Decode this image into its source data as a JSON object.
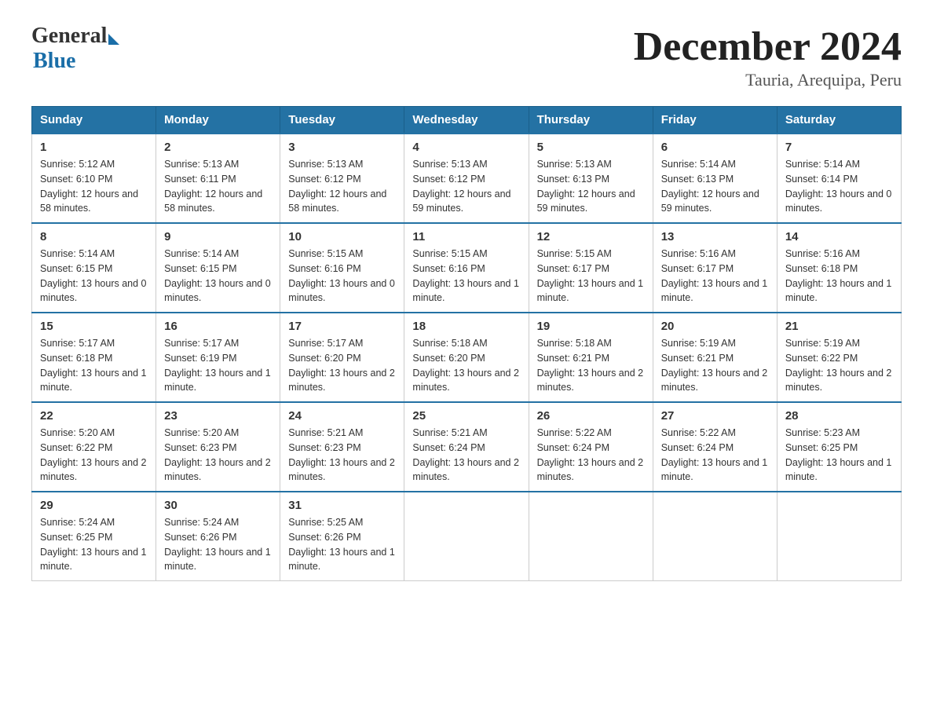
{
  "header": {
    "logo_general": "General",
    "logo_blue": "Blue",
    "month_title": "December 2024",
    "location": "Tauria, Arequipa, Peru"
  },
  "days_of_week": [
    "Sunday",
    "Monday",
    "Tuesday",
    "Wednesday",
    "Thursday",
    "Friday",
    "Saturday"
  ],
  "weeks": [
    [
      {
        "day": "1",
        "sunrise": "5:12 AM",
        "sunset": "6:10 PM",
        "daylight": "12 hours and 58 minutes."
      },
      {
        "day": "2",
        "sunrise": "5:13 AM",
        "sunset": "6:11 PM",
        "daylight": "12 hours and 58 minutes."
      },
      {
        "day": "3",
        "sunrise": "5:13 AM",
        "sunset": "6:12 PM",
        "daylight": "12 hours and 58 minutes."
      },
      {
        "day": "4",
        "sunrise": "5:13 AM",
        "sunset": "6:12 PM",
        "daylight": "12 hours and 59 minutes."
      },
      {
        "day": "5",
        "sunrise": "5:13 AM",
        "sunset": "6:13 PM",
        "daylight": "12 hours and 59 minutes."
      },
      {
        "day": "6",
        "sunrise": "5:14 AM",
        "sunset": "6:13 PM",
        "daylight": "12 hours and 59 minutes."
      },
      {
        "day": "7",
        "sunrise": "5:14 AM",
        "sunset": "6:14 PM",
        "daylight": "13 hours and 0 minutes."
      }
    ],
    [
      {
        "day": "8",
        "sunrise": "5:14 AM",
        "sunset": "6:15 PM",
        "daylight": "13 hours and 0 minutes."
      },
      {
        "day": "9",
        "sunrise": "5:14 AM",
        "sunset": "6:15 PM",
        "daylight": "13 hours and 0 minutes."
      },
      {
        "day": "10",
        "sunrise": "5:15 AM",
        "sunset": "6:16 PM",
        "daylight": "13 hours and 0 minutes."
      },
      {
        "day": "11",
        "sunrise": "5:15 AM",
        "sunset": "6:16 PM",
        "daylight": "13 hours and 1 minute."
      },
      {
        "day": "12",
        "sunrise": "5:15 AM",
        "sunset": "6:17 PM",
        "daylight": "13 hours and 1 minute."
      },
      {
        "day": "13",
        "sunrise": "5:16 AM",
        "sunset": "6:17 PM",
        "daylight": "13 hours and 1 minute."
      },
      {
        "day": "14",
        "sunrise": "5:16 AM",
        "sunset": "6:18 PM",
        "daylight": "13 hours and 1 minute."
      }
    ],
    [
      {
        "day": "15",
        "sunrise": "5:17 AM",
        "sunset": "6:18 PM",
        "daylight": "13 hours and 1 minute."
      },
      {
        "day": "16",
        "sunrise": "5:17 AM",
        "sunset": "6:19 PM",
        "daylight": "13 hours and 1 minute."
      },
      {
        "day": "17",
        "sunrise": "5:17 AM",
        "sunset": "6:20 PM",
        "daylight": "13 hours and 2 minutes."
      },
      {
        "day": "18",
        "sunrise": "5:18 AM",
        "sunset": "6:20 PM",
        "daylight": "13 hours and 2 minutes."
      },
      {
        "day": "19",
        "sunrise": "5:18 AM",
        "sunset": "6:21 PM",
        "daylight": "13 hours and 2 minutes."
      },
      {
        "day": "20",
        "sunrise": "5:19 AM",
        "sunset": "6:21 PM",
        "daylight": "13 hours and 2 minutes."
      },
      {
        "day": "21",
        "sunrise": "5:19 AM",
        "sunset": "6:22 PM",
        "daylight": "13 hours and 2 minutes."
      }
    ],
    [
      {
        "day": "22",
        "sunrise": "5:20 AM",
        "sunset": "6:22 PM",
        "daylight": "13 hours and 2 minutes."
      },
      {
        "day": "23",
        "sunrise": "5:20 AM",
        "sunset": "6:23 PM",
        "daylight": "13 hours and 2 minutes."
      },
      {
        "day": "24",
        "sunrise": "5:21 AM",
        "sunset": "6:23 PM",
        "daylight": "13 hours and 2 minutes."
      },
      {
        "day": "25",
        "sunrise": "5:21 AM",
        "sunset": "6:24 PM",
        "daylight": "13 hours and 2 minutes."
      },
      {
        "day": "26",
        "sunrise": "5:22 AM",
        "sunset": "6:24 PM",
        "daylight": "13 hours and 2 minutes."
      },
      {
        "day": "27",
        "sunrise": "5:22 AM",
        "sunset": "6:24 PM",
        "daylight": "13 hours and 1 minute."
      },
      {
        "day": "28",
        "sunrise": "5:23 AM",
        "sunset": "6:25 PM",
        "daylight": "13 hours and 1 minute."
      }
    ],
    [
      {
        "day": "29",
        "sunrise": "5:24 AM",
        "sunset": "6:25 PM",
        "daylight": "13 hours and 1 minute."
      },
      {
        "day": "30",
        "sunrise": "5:24 AM",
        "sunset": "6:26 PM",
        "daylight": "13 hours and 1 minute."
      },
      {
        "day": "31",
        "sunrise": "5:25 AM",
        "sunset": "6:26 PM",
        "daylight": "13 hours and 1 minute."
      },
      null,
      null,
      null,
      null
    ]
  ],
  "labels": {
    "sunrise": "Sunrise:",
    "sunset": "Sunset:",
    "daylight": "Daylight:"
  }
}
